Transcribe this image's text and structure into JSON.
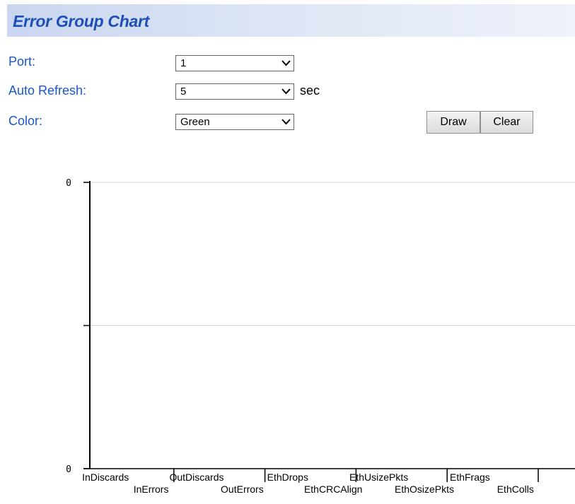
{
  "page": {
    "title": "Error Group Chart"
  },
  "form": {
    "port": {
      "label": "Port:",
      "value": "1"
    },
    "auto_refresh": {
      "label": "Auto Refresh:",
      "value": "5",
      "unit": "sec"
    },
    "color": {
      "label": "Color:",
      "value": "Green"
    },
    "draw_label": "Draw",
    "clear_label": "Clear"
  },
  "chart_data": {
    "type": "bar",
    "categories": [
      "InDiscards",
      "InErrors",
      "OutDiscards",
      "OutErrors",
      "EthDrops",
      "EthCRCAlign",
      "EthUsizePkts",
      "EthOsizePkts",
      "EthFrags",
      "EthColls"
    ],
    "values": [
      0,
      0,
      0,
      0,
      0,
      0,
      0,
      0,
      0,
      0
    ],
    "y_ticks": [
      "0",
      "0"
    ],
    "ylim": [
      0,
      0
    ],
    "grid": true,
    "legend": "none"
  }
}
